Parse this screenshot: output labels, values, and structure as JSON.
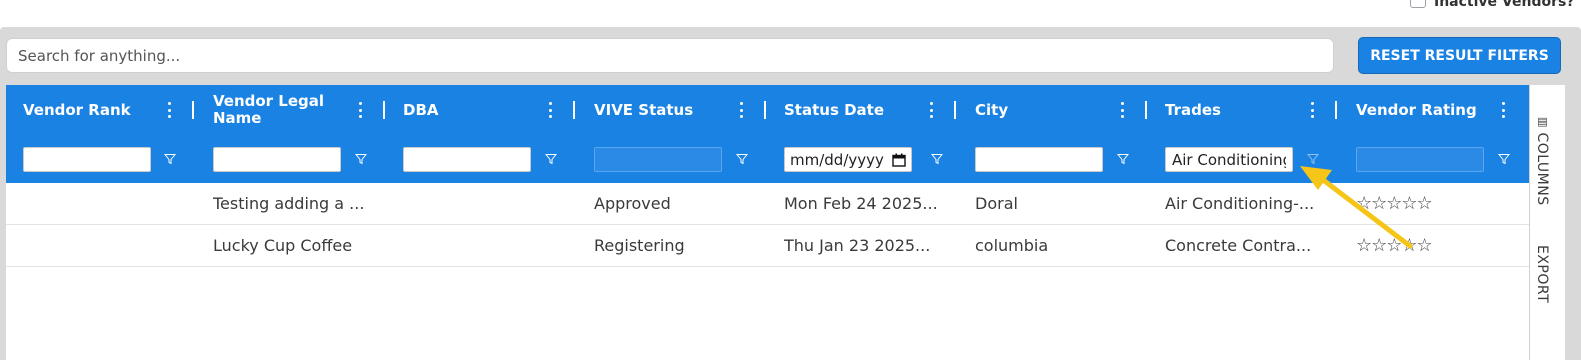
{
  "top": {
    "inactive_label": "Inactive Vendors?"
  },
  "search": {
    "placeholder": "Search for anything..."
  },
  "toolbar": {
    "reset_label": "RESET RESULT FILTERS"
  },
  "grid": {
    "columns": [
      {
        "label": "Vendor Rank",
        "filter_value": "",
        "filter_disabled": false
      },
      {
        "label": "Vendor Legal Name",
        "filter_value": "",
        "filter_disabled": false
      },
      {
        "label": "DBA",
        "filter_value": "",
        "filter_disabled": false
      },
      {
        "label": "VIVE Status",
        "filter_value": "",
        "filter_disabled": true
      },
      {
        "label": "Status Date",
        "filter_value": "mm/dd/yyyy",
        "filter_disabled": false
      },
      {
        "label": "City",
        "filter_value": "",
        "filter_disabled": false
      },
      {
        "label": "Trades",
        "filter_value": "Air Conditioning",
        "filter_disabled": false
      },
      {
        "label": "Vendor Rating",
        "filter_value": "",
        "filter_disabled": true
      }
    ],
    "rows": [
      {
        "rank": "",
        "legal_name": "Testing adding a ...",
        "dba": "",
        "status": "Approved",
        "status_date": "Mon Feb 24 2025...",
        "city": "Doral",
        "trades": "Air Conditioning-...",
        "rating": "☆☆☆☆☆"
      },
      {
        "rank": "",
        "legal_name": "Lucky Cup Coffee",
        "dba": "",
        "status": "Registering",
        "status_date": "Thu Jan 23 2025...",
        "city": "columbia",
        "trades": "Concrete Contra...",
        "rating": "☆☆☆☆☆"
      }
    ]
  },
  "side_panel": {
    "columns_label": "COLUMNS",
    "export_label": "EXPORT"
  },
  "colors": {
    "header_blue": "#1a82e2",
    "panel_gray": "#d9d9d9",
    "annotation_arrow": "#f5c518"
  }
}
